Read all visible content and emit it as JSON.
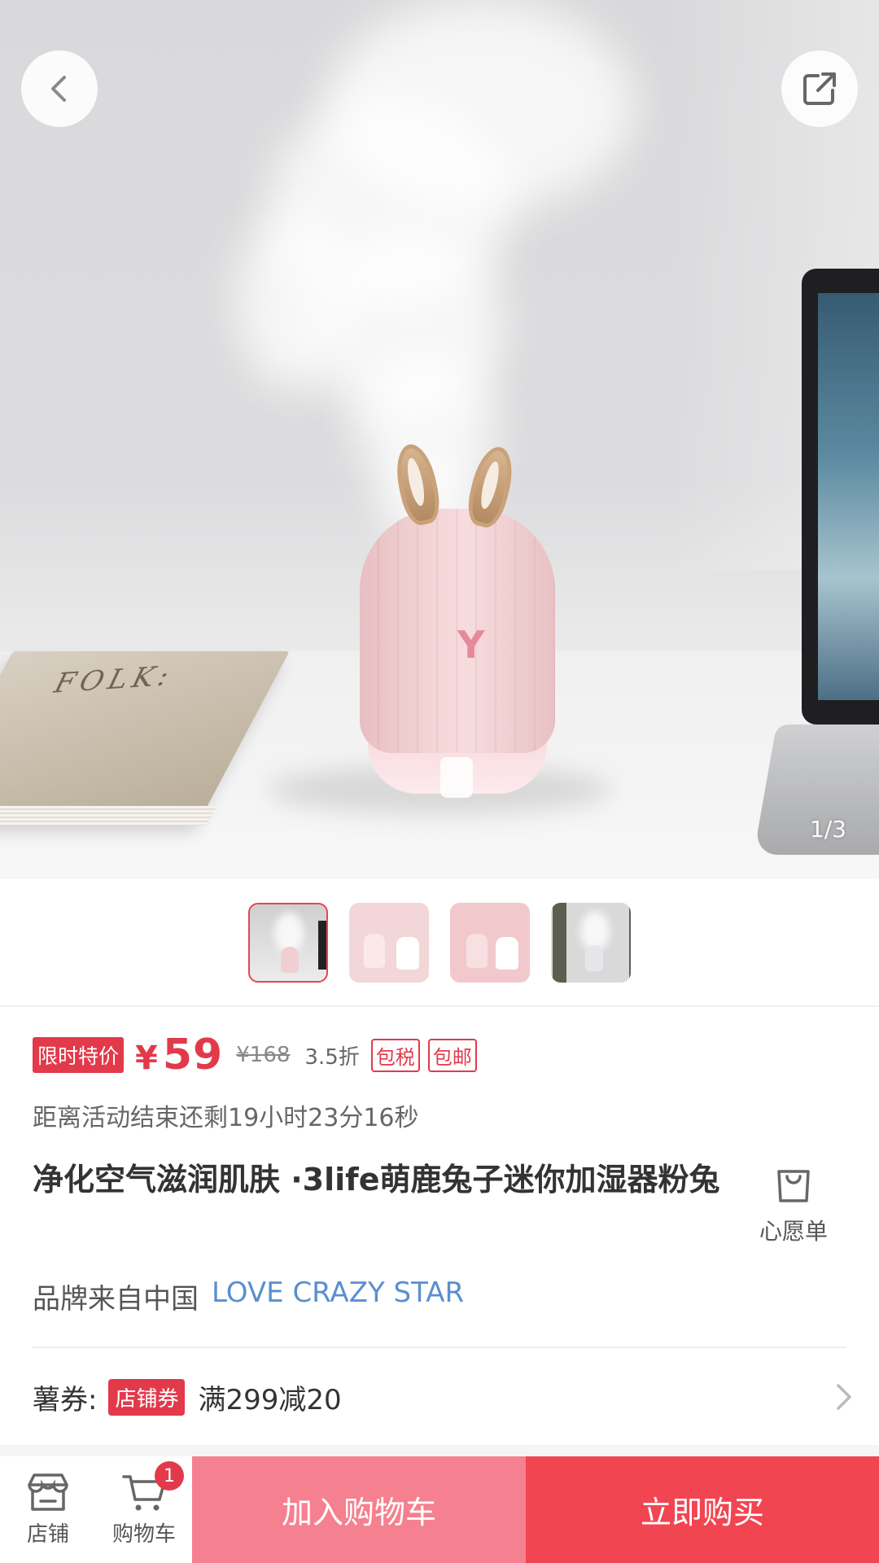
{
  "hero": {
    "page_indicator": "1/3",
    "book_text": "FOLK:",
    "product_image_icon": "rabbit-humidifier-photo"
  },
  "icons": {
    "back": "back-icon",
    "share": "share-icon",
    "wishlist": "shopping-bag-icon",
    "store": "store-icon",
    "cart": "cart-icon",
    "chevron": "chevron-right-icon"
  },
  "thumbnails": [
    {
      "id": "thumb-1",
      "active": true
    },
    {
      "id": "thumb-2",
      "active": false
    },
    {
      "id": "thumb-3",
      "active": false
    },
    {
      "id": "thumb-4",
      "active": false
    }
  ],
  "price": {
    "limited_tag": "限时特价",
    "currency": "¥",
    "current": "59",
    "original": "¥168",
    "discount": "3.5折",
    "badges": [
      "包税",
      "包邮"
    ]
  },
  "countdown": "距离活动结束还剩19小时23分16秒",
  "product": {
    "title": "净化空气滋润肌肤 ·3life萌鹿兔子迷你加湿器粉兔",
    "wishlist_label": "心愿单",
    "origin": "品牌来自中国",
    "brand": "LOVE CRAZY STAR"
  },
  "coupon": {
    "label": "薯券:",
    "tag": "店铺券",
    "text": "满299减20"
  },
  "bottom_bar": {
    "store_label": "店铺",
    "cart_label": "购物车",
    "cart_count": "1",
    "add_to_cart": "加入购物车",
    "buy_now": "立即购买"
  },
  "colors": {
    "accent": "#e23a4b",
    "add_to_cart_bg": "#f5808f",
    "buy_now_bg": "#f24552",
    "brand_link": "#5a8fd0"
  }
}
